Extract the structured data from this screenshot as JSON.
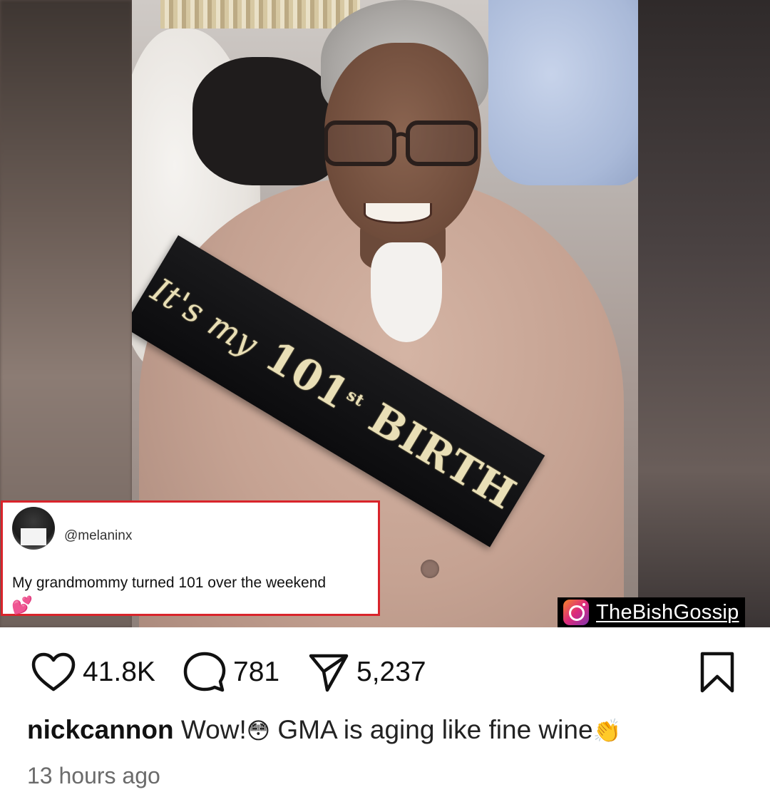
{
  "post": {
    "sash_text_script": "It's my",
    "sash_text_number": "101",
    "sash_text_suffix": "st",
    "sash_text_word": "BIRTH"
  },
  "tweet": {
    "handle": "@melaninx",
    "text": "My grandmommy turned 101 over the weekend",
    "emoji": "💕"
  },
  "watermark": {
    "icon": "instagram-icon",
    "text": "TheBishGossip"
  },
  "actions": {
    "likes": "41.8K",
    "comments": "781",
    "shares": "5,237"
  },
  "caption": {
    "username": "nickcannon",
    "text_part1": "Wow!",
    "emoji1": "😳",
    "text_part2": "GMA is aging like fine wine",
    "emoji2": "👏"
  },
  "timestamp": "13 hours ago",
  "colors": {
    "tweet_border": "#d9242b",
    "watermark_bg": "#000000"
  }
}
